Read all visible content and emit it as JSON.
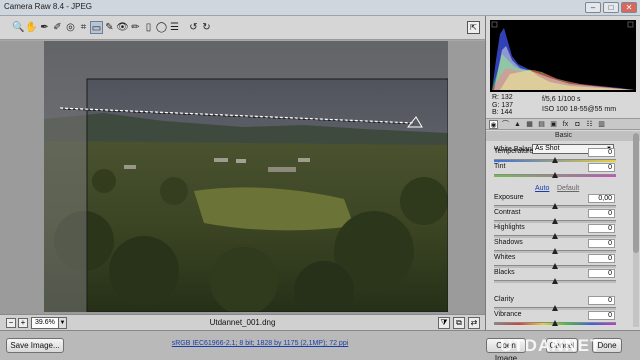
{
  "window": {
    "title": "Camera Raw 8.4  -  JPEG",
    "controls": [
      "minimize",
      "maximize",
      "close"
    ]
  },
  "toolbar": {
    "tools": [
      {
        "name": "zoom-tool",
        "glyph": "🔍"
      },
      {
        "name": "hand-tool",
        "glyph": "✋"
      },
      {
        "name": "white-balance-tool",
        "glyph": "✒"
      },
      {
        "name": "color-sampler-tool",
        "glyph": "✐"
      },
      {
        "name": "targeted-adjustment-tool",
        "glyph": "◎"
      },
      {
        "name": "crop-tool",
        "glyph": "⌗"
      },
      {
        "name": "straighten-tool",
        "glyph": "▭"
      },
      {
        "name": "spot-removal-tool",
        "glyph": "✎"
      },
      {
        "name": "red-eye-tool",
        "glyph": "👁"
      },
      {
        "name": "adjustment-brush-tool",
        "glyph": "✏"
      },
      {
        "name": "graduated-filter-tool",
        "glyph": "▯"
      },
      {
        "name": "radial-filter-tool",
        "glyph": "◯"
      },
      {
        "name": "preferences-tool",
        "glyph": "☰"
      },
      {
        "name": "rotate-left-tool",
        "glyph": "↺"
      },
      {
        "name": "rotate-right-tool",
        "glyph": "↻"
      }
    ],
    "selected_tool": "straighten-tool",
    "fullscreen_glyph": "⇱"
  },
  "preview": {
    "filename": "Utdannet_001.dng",
    "zoom": "39.6%"
  },
  "readout": {
    "r": "R:   132",
    "g": "G:   137",
    "b": "B:   144",
    "aperture_shutter": "f/5,6    1/100 s",
    "iso_lens": "ISO 100    18-55@55 mm"
  },
  "panel": {
    "section": "Basic",
    "white_balance_label": "White Balance:",
    "white_balance_value": "As Shot",
    "auto": "Auto",
    "default": "Default",
    "sliders": [
      {
        "key": "temperature",
        "label": "Temperature",
        "value": "0",
        "pos": 0.5
      },
      {
        "key": "tint",
        "label": "Tint",
        "value": "0",
        "pos": 0.5
      },
      {
        "key": "exposure",
        "label": "Exposure",
        "value": "0,00",
        "pos": 0.5
      },
      {
        "key": "contrast",
        "label": "Contrast",
        "value": "0",
        "pos": 0.5
      },
      {
        "key": "highlights",
        "label": "Highlights",
        "value": "0",
        "pos": 0.5
      },
      {
        "key": "shadows",
        "label": "Shadows",
        "value": "0",
        "pos": 0.5
      },
      {
        "key": "whites",
        "label": "Whites",
        "value": "0",
        "pos": 0.5
      },
      {
        "key": "blacks",
        "label": "Blacks",
        "value": "0",
        "pos": 0.5
      },
      {
        "key": "clarity",
        "label": "Clarity",
        "value": "0",
        "pos": 0.5
      },
      {
        "key": "vibrance",
        "label": "Vibrance",
        "value": "0",
        "pos": 0.5
      }
    ]
  },
  "footer": {
    "save_label": "Save Image...",
    "workflow": "sRGB IEC61966-2.1; 8 bit; 1828 by 1175 (2,1MP); 72 ppi",
    "open_label": "Open Image",
    "cancel_label": "Cancel",
    "done_label": "Done"
  },
  "watermark": "UTDANNET",
  "colors": {
    "tint_track": "#6fbf4a",
    "tint_track_end": "#c84fc8",
    "temp_track_start": "#3e6fd8",
    "temp_track_end": "#e8d23c"
  }
}
